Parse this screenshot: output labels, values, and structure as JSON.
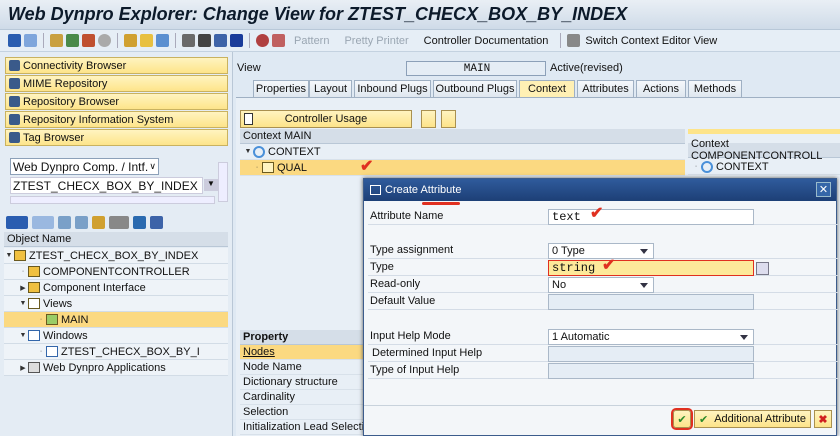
{
  "title": "Web Dynpro Explorer: Change View for ZTEST_CHECX_BOX_BY_INDEX",
  "toolbar": {
    "pattern": "Pattern",
    "pretty_printer": "Pretty Printer",
    "controller_documentation": "Controller Documentation",
    "switch_context": "Switch Context Editor View"
  },
  "left": {
    "nav_buttons": [
      "Connectivity Browser",
      "MIME Repository",
      "Repository Browser",
      "Repository Information System",
      "Tag Browser"
    ],
    "object_type": "Web Dynpro Comp. / Intf.",
    "object_name_value": "ZTEST_CHECX_BOX_BY_INDEX",
    "tree_header": "Object Name",
    "tree": [
      "ZTEST_CHECX_BOX_BY_INDEX",
      "COMPONENTCONTROLLER",
      "Component Interface",
      "Views",
      "MAIN",
      "Windows",
      "ZTEST_CHECX_BOX_BY_I",
      "Web Dynpro Applications"
    ]
  },
  "view": {
    "label": "View",
    "name": "MAIN",
    "status": "Active(revised)"
  },
  "tabs": [
    "Properties",
    "Layout",
    "Inbound Plugs",
    "Outbound Plugs",
    "Context",
    "Attributes",
    "Actions",
    "Methods"
  ],
  "context": {
    "controller_usage": "Controller Usage",
    "main_header": "Context MAIN",
    "root": "CONTEXT",
    "node": "QUAL",
    "cc_header": "Context COMPONENTCONTROLL",
    "cc_root": "CONTEXT"
  },
  "property": {
    "header": "Property",
    "rows": [
      "Nodes",
      "Node Name",
      "Dictionary structure",
      "Cardinality",
      "Selection",
      "Initialization Lead Selection"
    ]
  },
  "dialog": {
    "title": "Create Attribute",
    "labels": {
      "attr_name": "Attribute Name",
      "type_assignment": "Type assignment",
      "type": "Type",
      "read_only": "Read-only",
      "default_value": "Default Value",
      "input_help_mode": "Input Help Mode",
      "determined_help": "Determined Input Help",
      "type_of_help": "Type of Input Help"
    },
    "values": {
      "attr_name": "text",
      "type_assignment": "0 Type",
      "type": "string",
      "read_only": "No",
      "input_help_mode": "1 Automatic"
    },
    "additional_attribute": "Additional Attribute"
  },
  "colors": {
    "highlight": "#fbd981",
    "dialog_title": "#1d3f76",
    "annotation": "#e03020"
  }
}
